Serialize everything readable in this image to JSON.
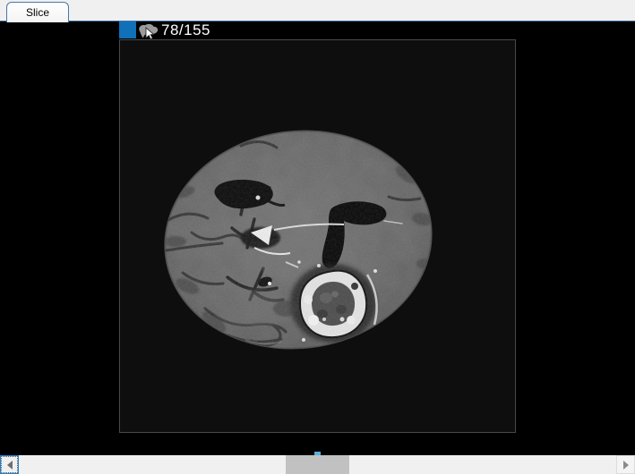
{
  "tab_bar": {
    "tabs": [
      {
        "label": "Slice",
        "selected": true
      }
    ]
  },
  "viewport": {
    "slice_label": "78/155",
    "slice_current": "78",
    "slice_total": "155",
    "swatch_color": "#1070b8",
    "annotation_text_color": "#ffffff"
  },
  "icons": {
    "swatch": "plane-color-swatch",
    "cursor": "mouse-cursor-icon",
    "scroll_left": "scroll-left-arrow-icon",
    "scroll_right": "scroll-right-arrow-icon"
  },
  "scrollbar": {
    "orientation": "horizontal",
    "track_color": "#f0f0f0",
    "thumb_color": "#c1c1c1",
    "focused_button_border": "#1d83d4"
  },
  "colors": {
    "tab_border_blue": "#4878a8",
    "tabbar_bg": "#f0f0f0",
    "client_bg": "#000000",
    "render_window_bg": "#0e0e0e",
    "render_window_border": "#4a4a4a",
    "slice_slider_tick": "#58aede"
  }
}
